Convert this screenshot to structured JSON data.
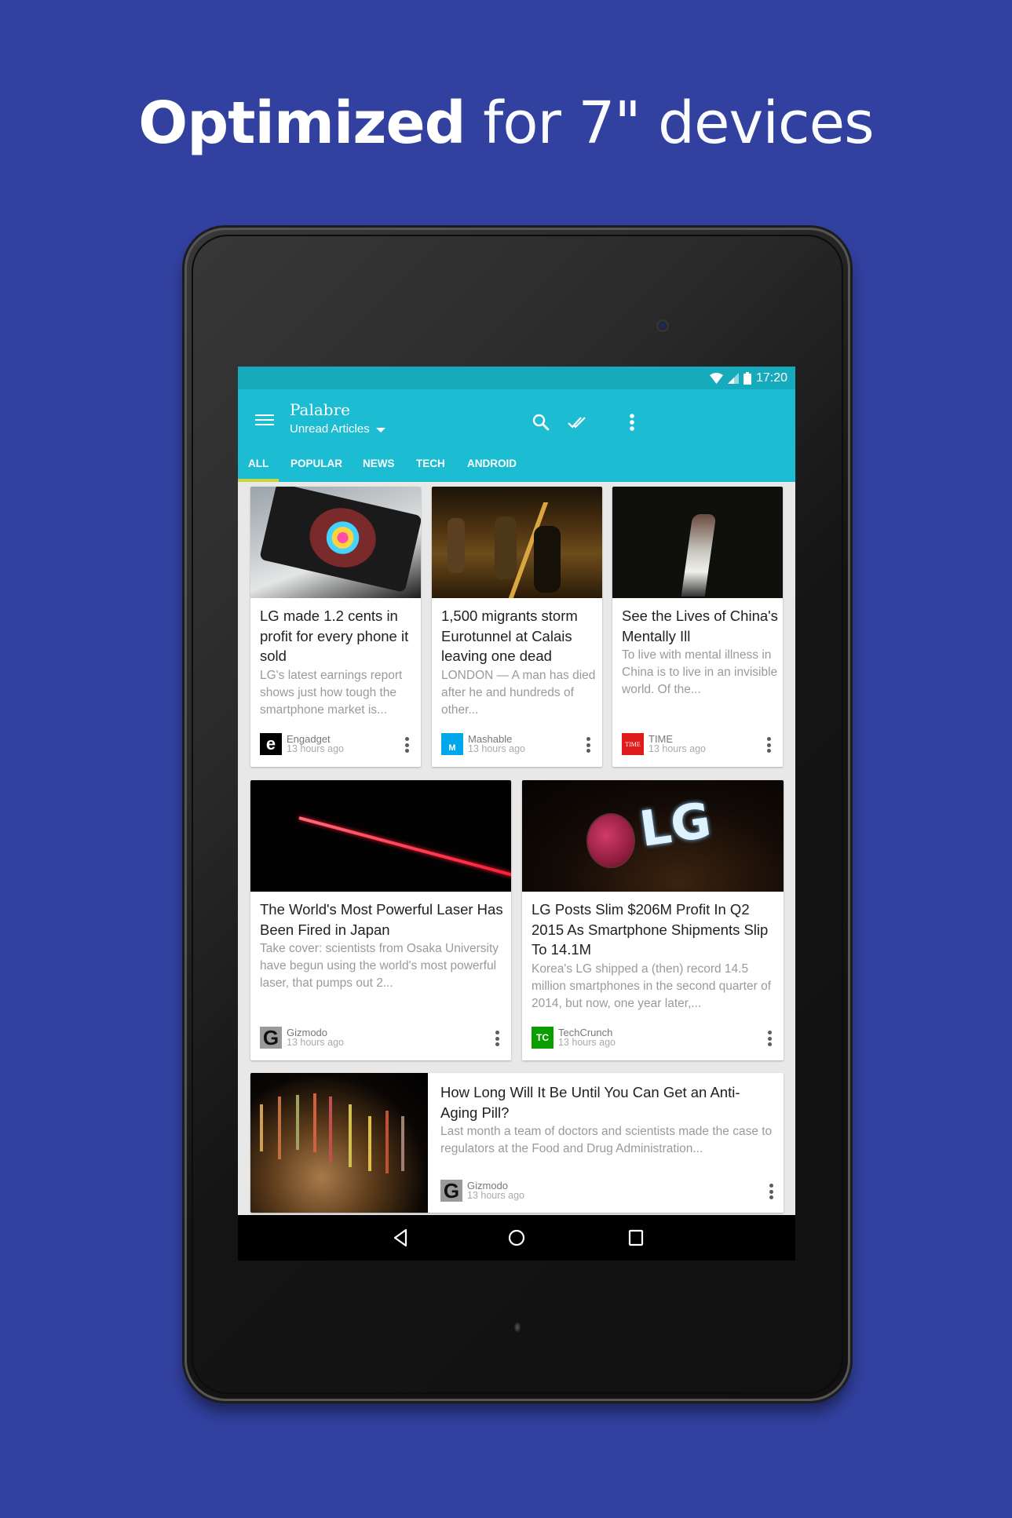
{
  "promo": {
    "headline_bold": "Optimized",
    "headline_rest": " for 7\" devices",
    "background_color": "#32409f"
  },
  "status_bar": {
    "time": "17:20",
    "icons": [
      "wifi-icon",
      "cell-signal-icon",
      "battery-icon"
    ]
  },
  "app_bar": {
    "title": "Palabre",
    "subtitle": "Unread Articles",
    "accent_color": "#1cbcd3",
    "actions": [
      "search-icon",
      "mark-all-read-icon",
      "overflow-menu-icon"
    ]
  },
  "tabs": [
    {
      "label": "ALL",
      "selected": true
    },
    {
      "label": "POPULAR",
      "selected": false
    },
    {
      "label": "NEWS",
      "selected": false
    },
    {
      "label": "TECH",
      "selected": false
    },
    {
      "label": "ANDROID",
      "selected": false
    }
  ],
  "tab_indicator_color": "#c8d83c",
  "articles": [
    {
      "title": "LG made 1.2 cents in profit for every phone it sold",
      "excerpt": "LG's latest earnings report shows just how tough the smartphone market is...",
      "source": "Engadget",
      "source_logo": "e",
      "source_color": "#000000",
      "time": "13 hours ago"
    },
    {
      "title": "1,500 migrants storm Eurotunnel at Calais leaving one dead",
      "excerpt": "LONDON — A man has died after he and hundreds of other...",
      "source": "Mashable",
      "source_logo": "M",
      "source_color": "#00a7e9",
      "time": "13 hours ago"
    },
    {
      "title": "See the Lives of China's Mentally Ill",
      "excerpt": "To live with mental illness in China is to live in an invisible world. Of the...",
      "source": "TIME",
      "source_logo": "TIME",
      "source_color": "#e01b1b",
      "time": "13 hours ago"
    },
    {
      "title": "The World's Most Powerful Laser Has Been Fired in Japan",
      "excerpt": "Take cover: scientists from Osaka University have begun using the world's most powerful laser, that pumps out 2...",
      "source": "Gizmodo",
      "source_logo": "G",
      "source_color": "#9a9a9a",
      "time": "13 hours ago"
    },
    {
      "title": "LG Posts Slim $206M Profit In Q2 2015 As Smartphone Shipments Slip To 14.1M",
      "excerpt": " Korea's LG shipped a (then) record 14.5 million smartphones in the second quarter of 2014, but now, one year later,...",
      "source": "TechCrunch",
      "source_logo": "TC",
      "source_color": "#0a9e01",
      "time": "13 hours ago"
    },
    {
      "title": "How Long Will It Be Until You Can Get an Anti-Aging Pill?",
      "excerpt": "Last month a team of doctors and scientists made the case to regulators at the Food and Drug Administration...",
      "source": "Gizmodo",
      "source_logo": "G",
      "source_color": "#9a9a9a",
      "time": "13 hours ago"
    }
  ],
  "nav_bar": {
    "buttons": [
      "back-icon",
      "home-icon",
      "recents-icon"
    ]
  }
}
